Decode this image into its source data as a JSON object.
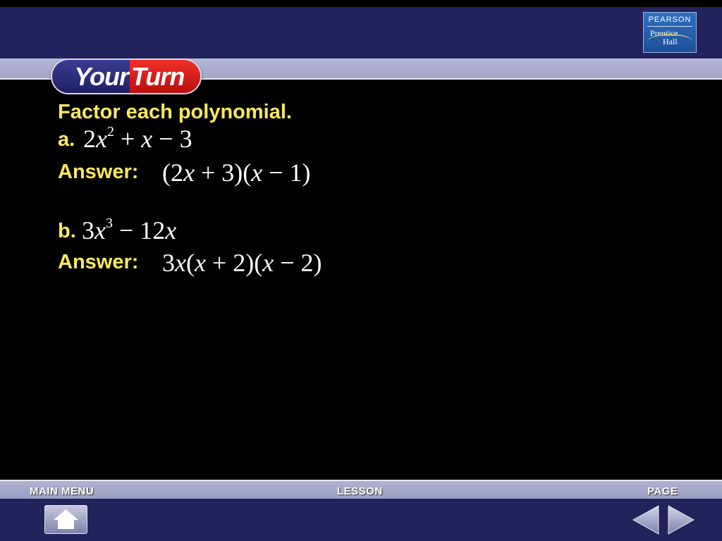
{
  "branding": {
    "publisher_top": "PEARSON",
    "publisher_line1": "Prentice",
    "publisher_line2": "Hall"
  },
  "badge": {
    "your": "Your",
    "turn": "Turn"
  },
  "problem": {
    "heading": "Factor each polynomial.",
    "parts": [
      {
        "label": "a.",
        "expression": "2x² + x − 3",
        "answer_label": "Answer:",
        "answer": "(2x + 3)(x − 1)"
      },
      {
        "label": "b.",
        "expression": "3x³ − 12x",
        "answer_label": "Answer:",
        "answer": "3x(x + 2)(x − 2)"
      }
    ]
  },
  "footer": {
    "main_menu": "MAIN MENU",
    "lesson": "LESSON",
    "page": "PAGE"
  },
  "icons": {
    "home": "home-icon",
    "prev": "arrow-left-icon",
    "next": "arrow-right-icon"
  },
  "colors": {
    "header": "#22225c",
    "accent_yellow": "#ffe85a",
    "badge_red": "#d8201b",
    "badge_blue": "#2a2a7a"
  }
}
